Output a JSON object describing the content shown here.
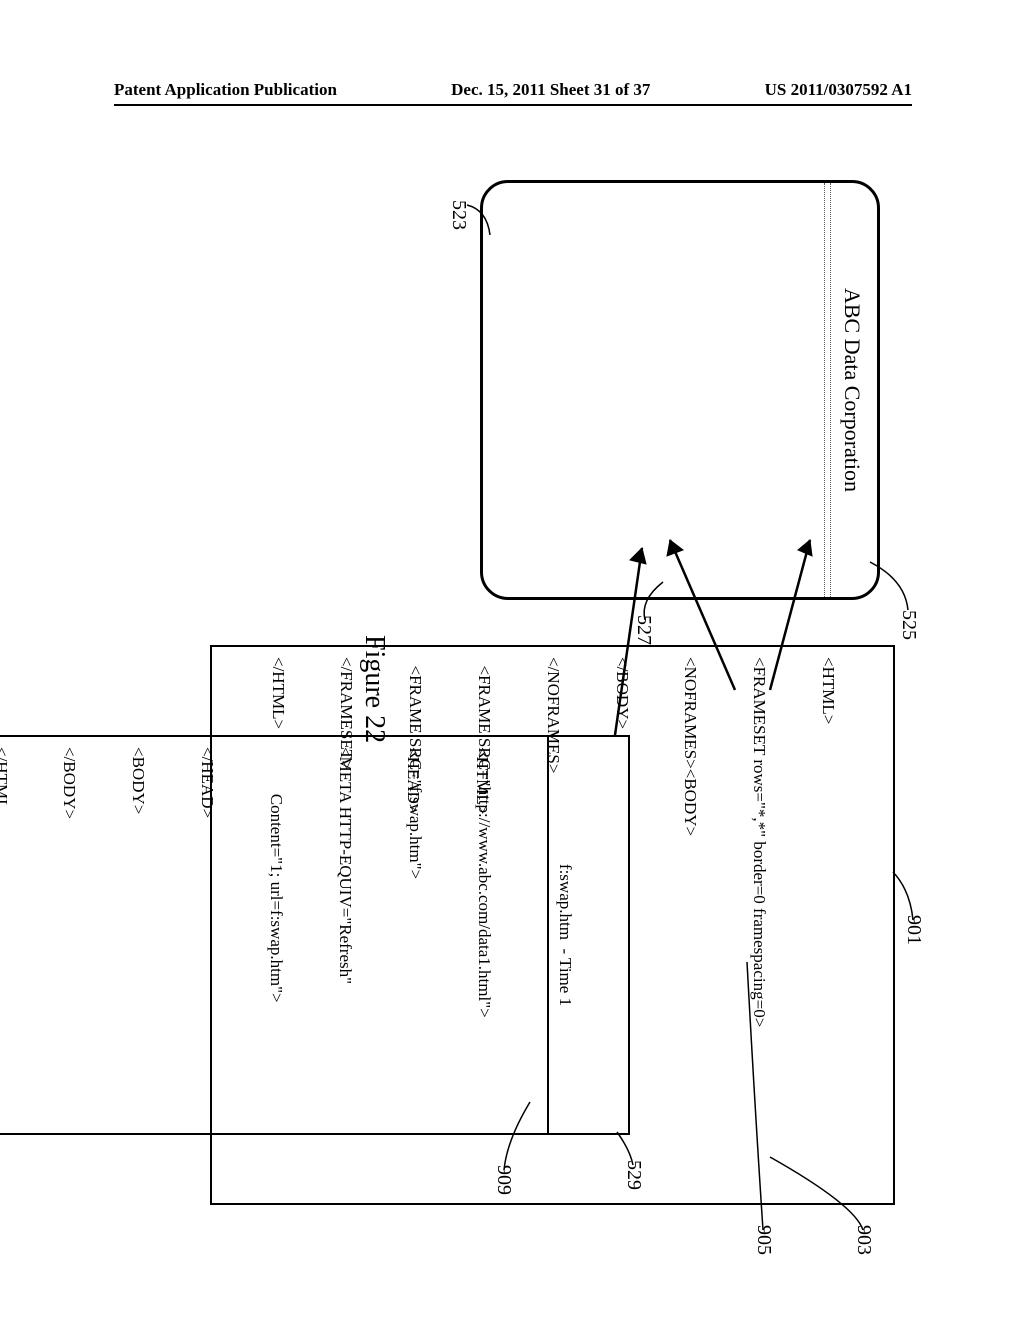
{
  "header": {
    "left": "Patent Application Publication",
    "center": "Dec. 15, 2011  Sheet 31 of 37",
    "right": "US 2011/0307592 A1"
  },
  "browser": {
    "title": "ABC Data Corporation"
  },
  "codebox1": {
    "lines": [
      "<HTML>",
      "<FRAMESET rows=\"*,*\" border=0 framespacing=0>",
      "<NOFRAMES><BODY>",
      "</BODY>",
      "</NOFRAMES>",
      "  <FRAME SRC=\"http://www.abc.com/data1.html\">",
      "  <FRAME SRC=\"f:swap.htm\">",
      "</FRAMESET>",
      "</HTML>"
    ]
  },
  "codebox2": {
    "title": "f:swap.htm  - Time 1",
    "lines": [
      "<HTML>",
      "<HEAD>",
      "<META HTTP-EQUIV=\"Refresh\"",
      "           Content=\"1; url=f:swap.htm\">",
      "</HEAD>",
      "<BODY>",
      "</BODY>",
      "</HTML"
    ]
  },
  "labels": {
    "l523": "523",
    "l525": "525",
    "l527": "527",
    "l529": "529",
    "l901": "901",
    "l903": "903",
    "l905": "905",
    "l909": "909"
  },
  "figure_caption": "Figure 22"
}
